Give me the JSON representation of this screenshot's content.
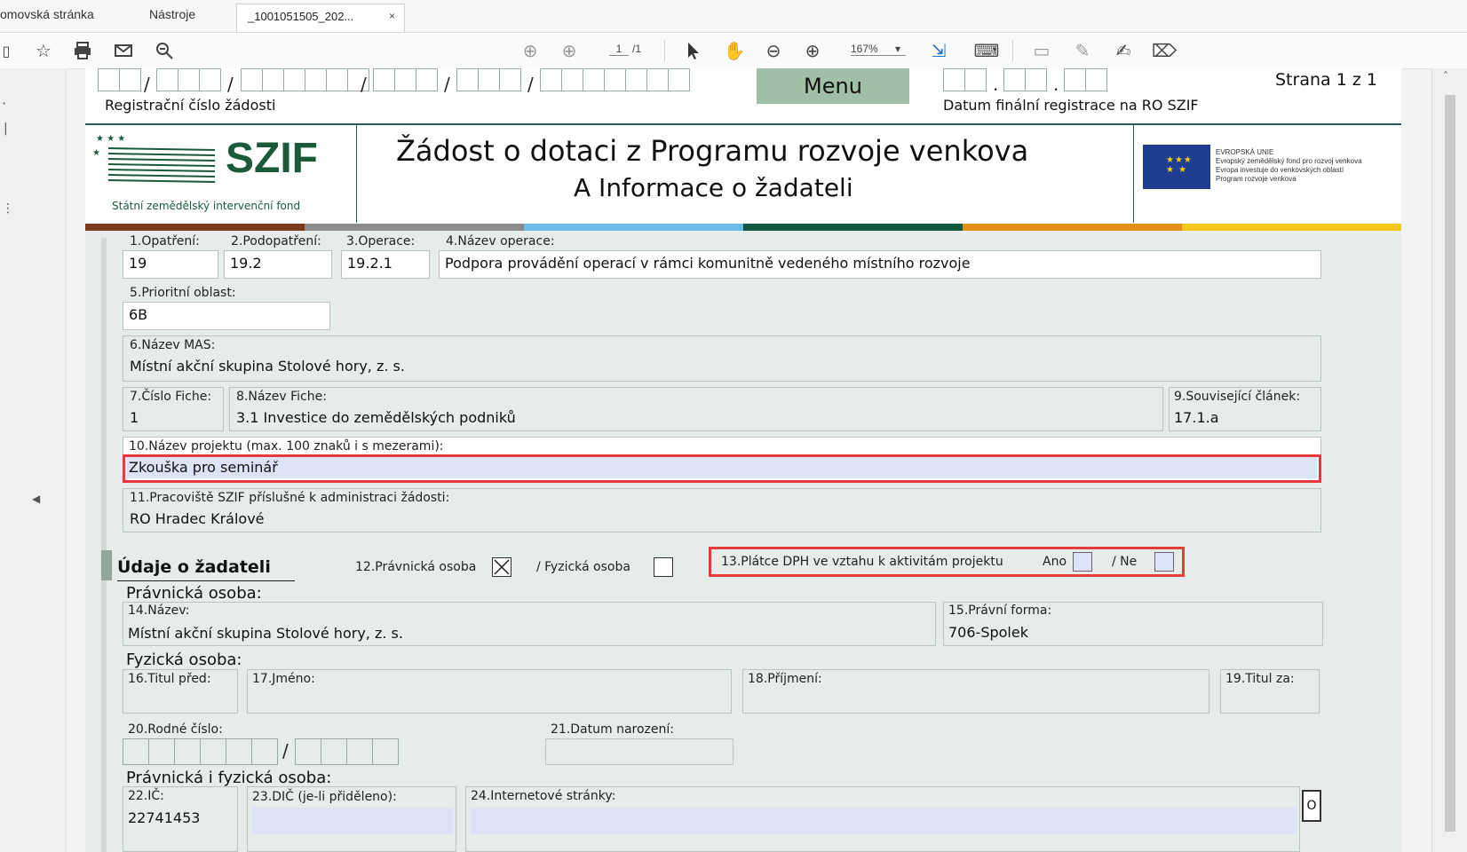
{
  "browser": {
    "tabs": [
      "omovská stránka",
      "Nástroje"
    ],
    "active_tab": "_1001051505_202...",
    "close_glyph": "×"
  },
  "toolbar": {
    "page_current": "1",
    "page_total": "/1",
    "zoom": "167%"
  },
  "header": {
    "menu_label": "Menu",
    "page_info": "Strana 1 z 1",
    "reg_label": "Registrační číslo žádosti",
    "date_label": "Datum finální registrace na RO SZIF",
    "title_line1": "Žádost o dotaci z Programu rozvoje venkova",
    "title_line2": "A Informace o žadateli",
    "logo_text": "SZIF",
    "logo_subtitle": "Státní zemědělský intervenční fond",
    "eu_lines": [
      "EVROPSKÁ UNIE",
      "Evropský zemědělský fond pro rozvoj venkova",
      "Evropa investuje do venkovských oblastí",
      "Program rozvoje venkova"
    ],
    "stripe_colors": [
      "#7a3b1e",
      "#8c8c8c",
      "#6bbde6",
      "#0f5a3f",
      "#e3901b",
      "#f5c518"
    ]
  },
  "form": {
    "f1_label": "1.Opatření:",
    "f1_value": "19",
    "f2_label": "2.Podopatření:",
    "f2_value": "19.2",
    "f3_label": "3.Operace:",
    "f3_value": "19.2.1",
    "f4_label": "4.Název operace:",
    "f4_value": "Podpora provádění operací v rámci komunitně vedeného místního rozvoje",
    "f5_label": "5.Prioritní oblast:",
    "f5_value": "6B",
    "f6_label": "6.Název MAS:",
    "f6_value": "Místní akční skupina Stolové hory, z. s.",
    "f7_label": "7.Číslo Fiche:",
    "f7_value": "1",
    "f8_label": "8.Název Fiche:",
    "f8_value": "3.1 Investice do zemědělských podniků",
    "f9_label": "9.Související článek:",
    "f9_value": "17.1.a",
    "f10_label": "10.Název projektu (max. 100 znaků i s mezerami):",
    "f10_value": "Zkouška pro seminář",
    "f11_label": "11.Pracoviště SZIF příslušné k administraci žádosti:",
    "f11_value": "RO Hradec Králové",
    "section_applicant": "Údaje o žadateli",
    "f12_label": "12.Právnická osoba",
    "f12_fyz": "/  Fyzická osoba",
    "f13_label": "13.Plátce DPH ve vztahu k aktivitám projektu",
    "f13_ano": "Ano",
    "f13_ne": "/  Ne",
    "pravnicka_header": "Právnická osoba:",
    "f14_label": "14.Název:",
    "f14_value": "Místní akční skupina Stolové hory, z. s.",
    "f15_label": "15.Právní forma:",
    "f15_value": "706-Spolek",
    "fyzicka_header": "Fyzická osoba:",
    "f16_label": "16.Titul před:",
    "f17_label": "17.Jméno:",
    "f18_label": "18.Příjmení:",
    "f19_label": "19.Titul za:",
    "f20_label": "20.Rodné číslo:",
    "f21_label": "21.Datum narození:",
    "both_header": "Právnická i fyzická osoba:",
    "f22_label": "22.IČ:",
    "f22_value": "22741453",
    "f23_label": "23.DIČ (je-li přiděleno):",
    "f24_label": "24.Internetové stránky:",
    "side_btn": "O"
  }
}
